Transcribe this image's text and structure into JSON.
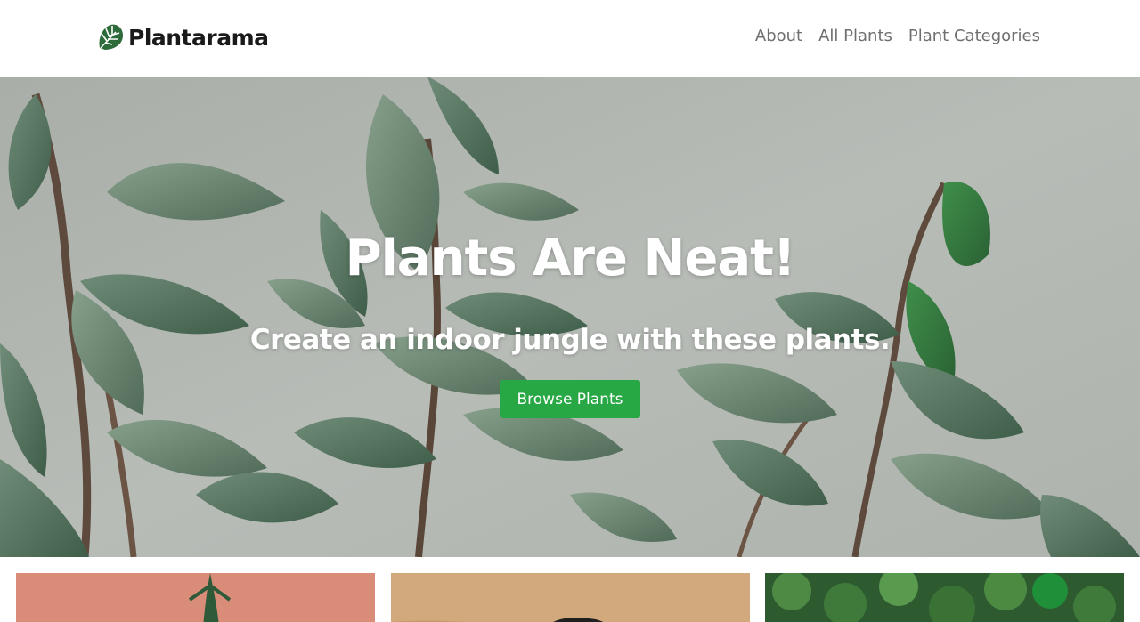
{
  "header": {
    "brand": {
      "name": "Plantarama",
      "icon": "monstera-leaf-icon"
    },
    "nav": [
      {
        "label": "About"
      },
      {
        "label": "All Plants"
      },
      {
        "label": "Plant Categories"
      }
    ]
  },
  "hero": {
    "title": "Plants Are Neat!",
    "subtitle": "Create an indoor jungle with these plants.",
    "cta_label": "Browse Plants"
  },
  "colors": {
    "accent": "#28a745",
    "hero_background": "#b3b8b3",
    "leaf_dark": "#3f5e4a",
    "brand_green": "#2e6b3a"
  },
  "cards": [
    {
      "image": "plant-card-image-coral"
    },
    {
      "image": "plant-card-image-tan"
    },
    {
      "image": "plant-card-image-green-foliage"
    }
  ]
}
